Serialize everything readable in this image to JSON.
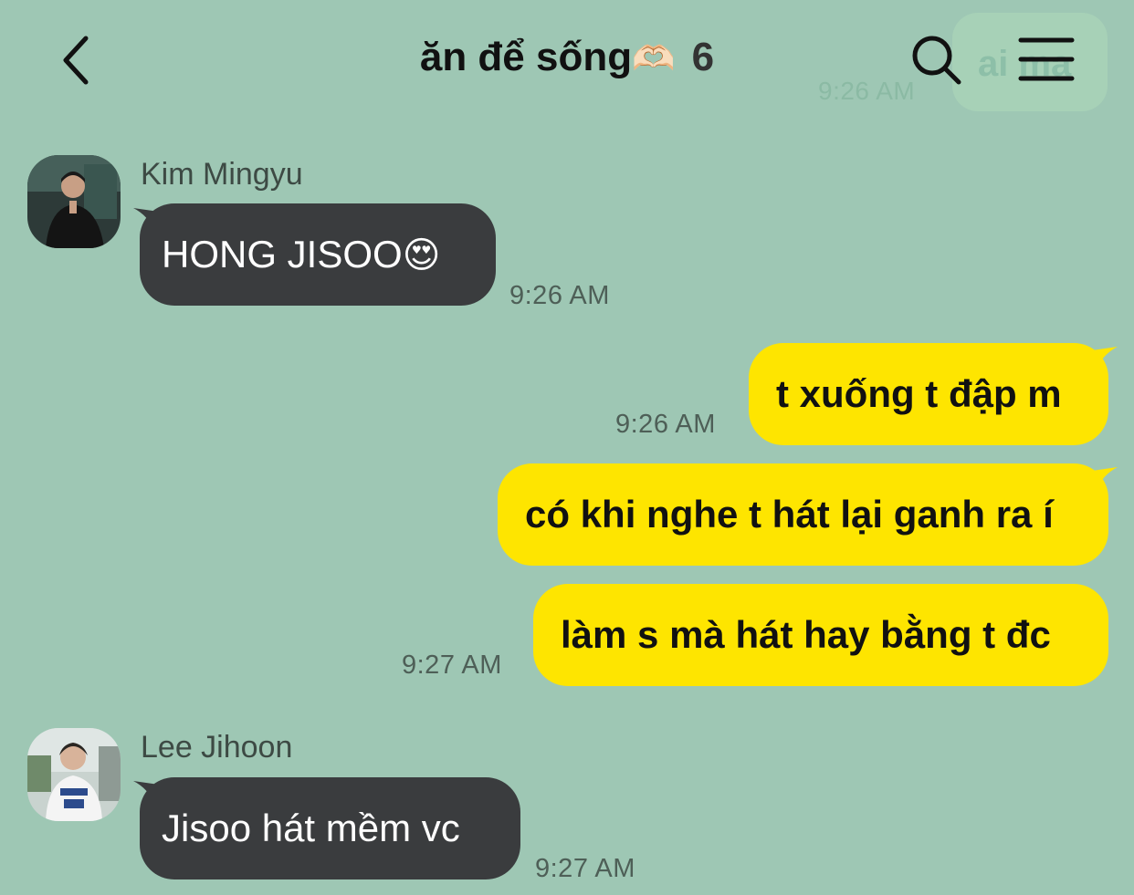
{
  "header": {
    "back_icon": "chevron-left-icon",
    "title": "ăn để sống",
    "title_emoji": "🫶🏻",
    "member_count": "6",
    "search_icon": "search-icon",
    "menu_icon": "menu-icon",
    "pinned_preview_text": "ai ma",
    "pinned_preview_time": "9:26 AM"
  },
  "colors": {
    "background": "#9ec7b4",
    "incoming_bubble": "#3a3c3e",
    "outgoing_bubble": "#fee500"
  },
  "messages": [
    {
      "direction": "incoming",
      "sender": "Kim Mingyu",
      "avatar": "user-avatar",
      "text": "HONG JISOO",
      "emoji": "😍",
      "time": "9:26 AM"
    },
    {
      "direction": "outgoing",
      "text": "t xuống t đập m",
      "time": "9:26 AM"
    },
    {
      "direction": "outgoing",
      "text": "có khi nghe t hát lại ganh ra í",
      "time": ""
    },
    {
      "direction": "outgoing",
      "text": "làm s mà hát hay bằng t đc",
      "time": "9:27 AM"
    },
    {
      "direction": "incoming",
      "sender": "Lee Jihoon",
      "avatar": "user-avatar",
      "text": "Jisoo hát mềm vc",
      "time": "9:27 AM"
    }
  ]
}
